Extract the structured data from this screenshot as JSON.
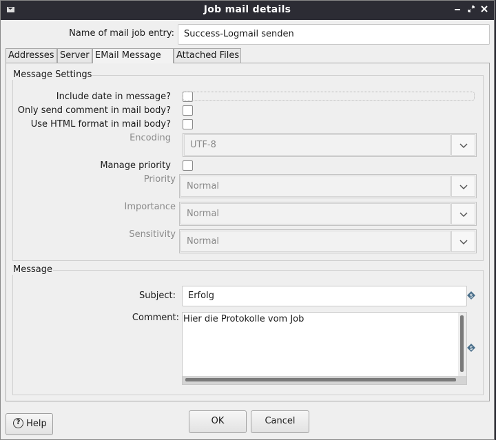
{
  "window": {
    "title": "Job mail details"
  },
  "name_field": {
    "label": "Name of mail job entry:",
    "value": "Success-Logmail senden"
  },
  "tabs": [
    {
      "label": "Addresses"
    },
    {
      "label": "Server"
    },
    {
      "label": "EMail Message",
      "active": true
    },
    {
      "label": "Attached Files"
    }
  ],
  "message_settings": {
    "title": "Message Settings",
    "include_date": {
      "label": "Include date in message?",
      "checked": false
    },
    "only_comment": {
      "label": "Only send comment in mail body?",
      "checked": false
    },
    "use_html": {
      "label": "Use HTML format in mail body?",
      "checked": false
    },
    "encoding": {
      "label": "Encoding",
      "value": "UTF-8"
    },
    "manage_priority": {
      "label": "Manage priority",
      "checked": false
    },
    "priority": {
      "label": "Priority",
      "value": "Normal"
    },
    "importance": {
      "label": "Importance",
      "value": "Normal"
    },
    "sensitivity": {
      "label": "Sensitivity",
      "value": "Normal"
    }
  },
  "message": {
    "title": "Message",
    "subject": {
      "label": "Subject:",
      "value": "Erfolg"
    },
    "comment": {
      "label": "Comment:",
      "value": "Hier die Protokolle vom Job"
    }
  },
  "buttons": {
    "ok": "OK",
    "cancel": "Cancel",
    "help": "Help"
  },
  "icons": {
    "variable": "variable-icon",
    "help": "help-icon",
    "app": "mail-icon"
  },
  "colors": {
    "titlebar": "#2c2c34",
    "window_bg": "#efefef",
    "variable_icon": "#4a6f8a"
  }
}
